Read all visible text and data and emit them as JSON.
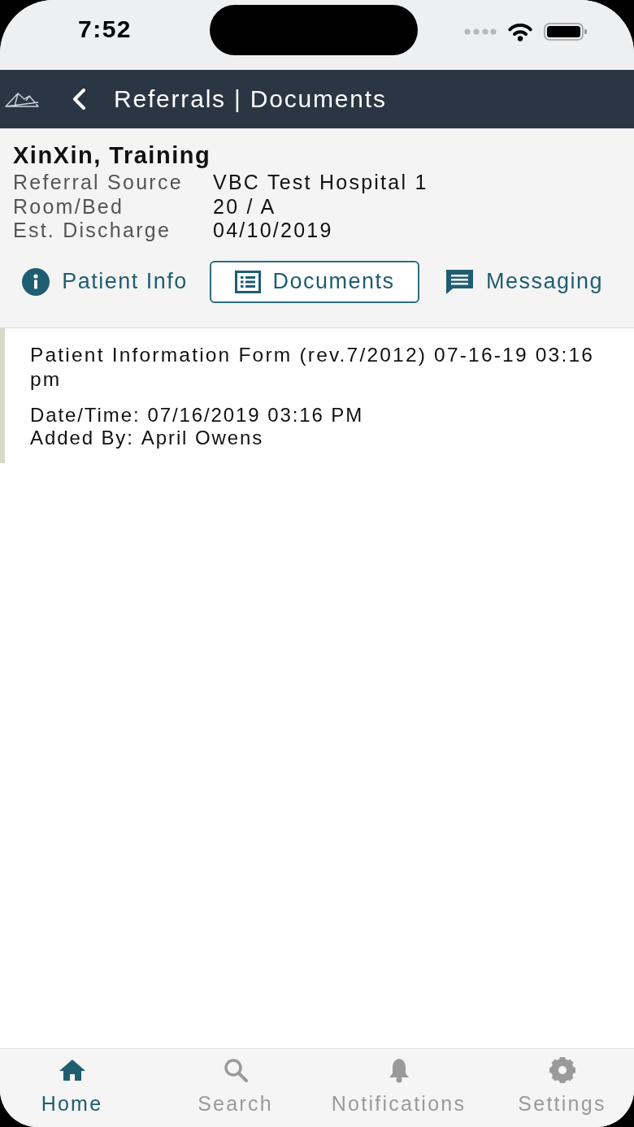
{
  "status_bar": {
    "time": "7:52"
  },
  "nav_bar": {
    "title": "Referrals | Documents"
  },
  "patient": {
    "name": "XinXin, Training",
    "details": [
      {
        "label": "Referral Source",
        "value": "VBC Test Hospital 1"
      },
      {
        "label": "Room/Bed",
        "value": "20 / A"
      },
      {
        "label": "Est. Discharge",
        "value": "04/10/2019"
      }
    ]
  },
  "tabs": [
    {
      "label": "Patient Info",
      "selected": false
    },
    {
      "label": "Documents",
      "selected": true
    },
    {
      "label": "Messaging",
      "selected": false
    }
  ],
  "documents": [
    {
      "title": "Patient Information Form (rev.7/2012) 07-16-19 03:16 pm",
      "fields": [
        {
          "label": "Date/Time:",
          "value": "07/16/2019 03:16 PM"
        },
        {
          "label": "Added By:",
          "value": "April Owens"
        }
      ]
    }
  ],
  "bottom_tabs": [
    {
      "label": "Home",
      "selected": true
    },
    {
      "label": "Search",
      "selected": false
    },
    {
      "label": "Notifications",
      "selected": false
    },
    {
      "label": "Settings",
      "selected": false
    }
  ]
}
